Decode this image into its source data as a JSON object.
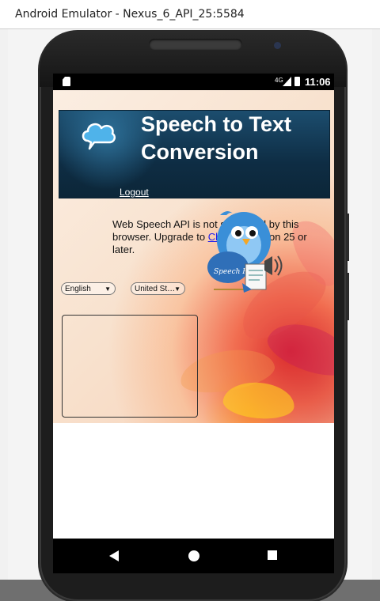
{
  "window": {
    "title": "Android Emulator - Nexus_6_API_25:5584"
  },
  "status_bar": {
    "time": "11:06",
    "network": "4G"
  },
  "app": {
    "banner_title": "Speech to Text Conversion",
    "logout_label": "Logout",
    "info_prefix": "Web Speech API is not supported by this browser. Upgrade to ",
    "info_link": "Chrome",
    "info_suffix": " version 25 or later.",
    "bird_text": "Speech Fun",
    "language_select": "English",
    "region_select": "United St…",
    "transcript_value": ""
  },
  "nav": {
    "back": "back-icon",
    "home": "home-icon",
    "recents": "recents-icon"
  },
  "colors": {
    "banner": "#0e2d44",
    "link": "#1a1aee",
    "phone": "#1d1d1d"
  }
}
